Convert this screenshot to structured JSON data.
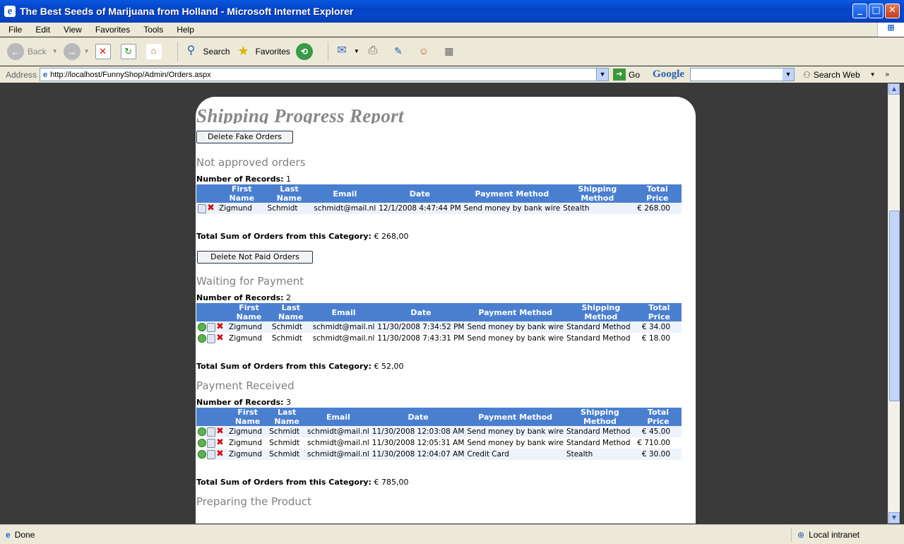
{
  "window": {
    "title": "The Best Seeds of Marijuana from Holland - Microsoft Internet Explorer"
  },
  "menu": [
    "File",
    "Edit",
    "View",
    "Favorites",
    "Tools",
    "Help"
  ],
  "toolbar": {
    "back": "Back",
    "search": "Search",
    "favorites": "Favorites"
  },
  "address": {
    "label": "Address",
    "url": "http://localhost/FunnyShop/Admin/Orders.aspx",
    "go": "Go"
  },
  "google": {
    "logo": "Google",
    "search_web": "Search Web"
  },
  "page": {
    "heading": "Shipping Progress Report",
    "delete_fake_button": "Delete Fake Orders",
    "delete_not_paid_button": "Delete Not Paid Orders",
    "records_label": "Number of Records:",
    "total_label": "Total Sum of Orders from this Category:",
    "columns": [
      "First Name",
      "Last Name",
      "Email",
      "Date",
      "Payment Method",
      "Shipping Method",
      "Total Price"
    ],
    "sections": [
      {
        "title": "Not approved orders",
        "count": "1",
        "total": "€ 268,00",
        "rows": [
          [
            "Zigmund",
            "Schmidt",
            "schmidt@mail.nl",
            "12/1/2008 4:47:44 PM",
            "Send money by bank wire",
            "Stealth",
            "€ 268.00"
          ]
        ]
      },
      {
        "title": "Waiting for Payment",
        "count": "2",
        "total": "€ 52,00",
        "rows": [
          [
            "Zigmund",
            "Schmidt",
            "schmidt@mail.nl",
            "11/30/2008 7:34:52 PM",
            "Send money by bank wire",
            "Standard Method",
            "€ 34.00"
          ],
          [
            "Zigmund",
            "Schmidt",
            "schmidt@mail.nl",
            "11/30/2008 7:43:31 PM",
            "Send money by bank wire",
            "Standard Method",
            "€ 18.00"
          ]
        ]
      },
      {
        "title": "Payment Received",
        "count": "3",
        "total": "€ 785,00",
        "rows": [
          [
            "Zigmund",
            "Schmidt",
            "schmidt@mail.nl",
            "11/30/2008 12:03:08 AM",
            "Send money by bank wire",
            "Standard Method",
            "€ 45.00"
          ],
          [
            "Zigmund",
            "Schmidt",
            "schmidt@mail.nl",
            "11/30/2008 12:05:31 AM",
            "Send money by bank wire",
            "Standard Method",
            "€ 710.00"
          ],
          [
            "Zigmund",
            "Schmidt",
            "schmidt@mail.nl",
            "11/30/2008 12:04:07 AM",
            "Credit Card",
            "Stealth",
            "€ 30.00"
          ]
        ]
      },
      {
        "title": "Preparing the Product"
      }
    ]
  },
  "status": {
    "text": "Done",
    "zone": "Local intranet"
  },
  "colors": {
    "header": "#4a7fd0",
    "section_title": "#808080",
    "title_bar": "#0443c6"
  }
}
